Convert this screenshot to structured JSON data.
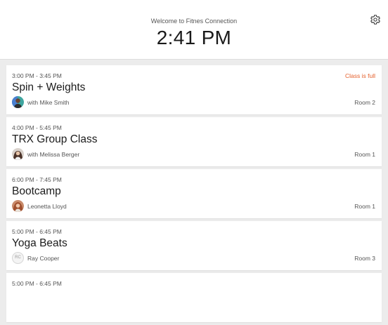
{
  "header": {
    "welcome": "Welcome to Fitnes Connection",
    "clock": "2:41 PM",
    "settings_icon": "gear-icon"
  },
  "classes": [
    {
      "time": "3:00 PM - 3:45 PM",
      "status": "Class is full",
      "title": "Spin + Weights",
      "instructor": "with Mike Smith",
      "room": "Room 2",
      "avatar": "photo"
    },
    {
      "time": "4:00 PM - 5:45 PM",
      "status": "",
      "title": "TRX Group Class",
      "instructor": "with Melissa Berger",
      "room": "Room 1",
      "avatar": "photo"
    },
    {
      "time": "6:00 PM - 7:45 PM",
      "status": "",
      "title": "Bootcamp",
      "instructor": "Leonetta Lloyd",
      "room": "Room 1",
      "avatar": "photo"
    },
    {
      "time": "5:00 PM - 6:45 PM",
      "status": "",
      "title": "Yoga Beats",
      "instructor": "Ray Cooper",
      "room": "Room 3",
      "avatar": "initials",
      "initials": "RC"
    },
    {
      "time": "5:00 PM - 6:45 PM",
      "status": "",
      "title": "",
      "instructor": "",
      "room": "",
      "avatar": "none"
    }
  ],
  "colors": {
    "background": "#ececec",
    "card": "#ffffff",
    "status_full": "#e5602c"
  }
}
